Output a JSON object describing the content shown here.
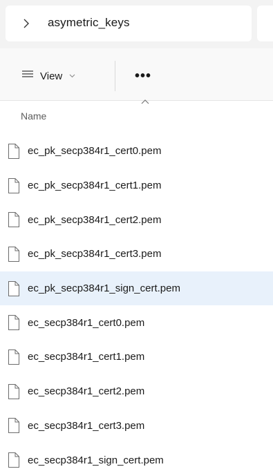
{
  "address": {
    "path": "asymetric_keys"
  },
  "toolbar": {
    "view_label": "View",
    "more_label": "•••"
  },
  "columns": {
    "name": "Name"
  },
  "files": [
    {
      "name": "ec_pk_secp384r1_cert0.pem",
      "selected": false
    },
    {
      "name": "ec_pk_secp384r1_cert1.pem",
      "selected": false
    },
    {
      "name": "ec_pk_secp384r1_cert2.pem",
      "selected": false
    },
    {
      "name": "ec_pk_secp384r1_cert3.pem",
      "selected": false
    },
    {
      "name": "ec_pk_secp384r1_sign_cert.pem",
      "selected": true
    },
    {
      "name": "ec_secp384r1_cert0.pem",
      "selected": false
    },
    {
      "name": "ec_secp384r1_cert1.pem",
      "selected": false
    },
    {
      "name": "ec_secp384r1_cert2.pem",
      "selected": false
    },
    {
      "name": "ec_secp384r1_cert3.pem",
      "selected": false
    },
    {
      "name": "ec_secp384r1_sign_cert.pem",
      "selected": false
    }
  ],
  "colors": {
    "selected_row": "#e8f1fb",
    "background": "#ffffff",
    "toolbar": "#f9f9f9"
  }
}
